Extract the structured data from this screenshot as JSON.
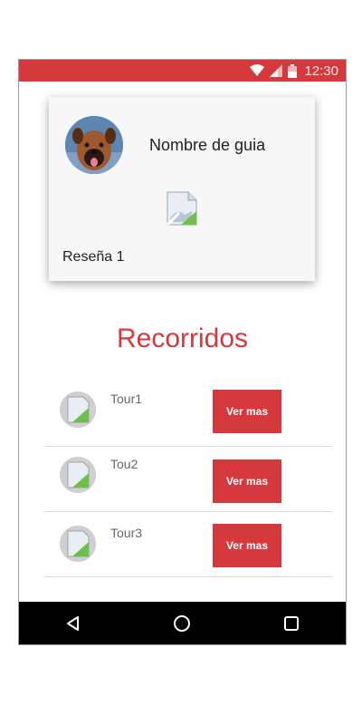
{
  "status_bar": {
    "time": "12:30",
    "icons": [
      "wifi-icon",
      "signal-icon",
      "battery-icon"
    ]
  },
  "guide_card": {
    "name": "Nombre de guia",
    "review": "Reseña 1",
    "avatar": "dog-avatar"
  },
  "section": {
    "title": "Recorridos"
  },
  "tours": [
    {
      "name": "Tour1",
      "button": "Ver mas"
    },
    {
      "name": "Tou2",
      "button": "Ver mas"
    },
    {
      "name": "Tour3",
      "button": "Ver mas"
    }
  ],
  "nav": {
    "buttons": [
      "back-icon",
      "home-icon",
      "recents-icon"
    ]
  },
  "colors": {
    "accent": "#d5393d",
    "nav_bar": "#000000"
  }
}
